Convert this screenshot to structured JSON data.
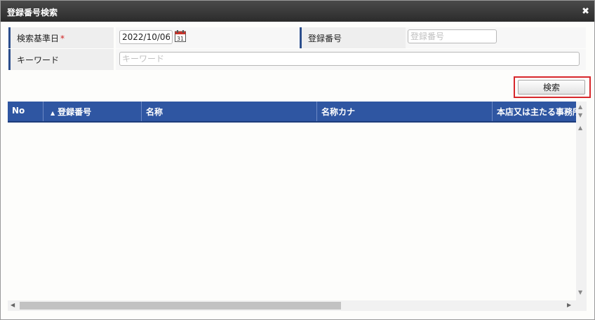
{
  "dialog": {
    "title": "登録番号検索",
    "close_icon": "close-icon",
    "close_glyph": "✖"
  },
  "form": {
    "date_label": "検索基準日",
    "required_mark": "*",
    "date_value": "2022/10/06",
    "calendar_icon": "calendar-icon",
    "calendar_day": "31",
    "regno_label": "登録番号",
    "regno_placeholder": "登録番号",
    "keyword_label": "キーワード",
    "keyword_placeholder": "キーワード"
  },
  "actions": {
    "search_label": "検索"
  },
  "grid": {
    "columns": [
      {
        "label": "No",
        "sort": ""
      },
      {
        "label": "登録番号",
        "sort": "▲"
      },
      {
        "label": "名称",
        "sort": ""
      },
      {
        "label": "名称カナ",
        "sort": ""
      },
      {
        "label": "本店又は主たる事務所",
        "sort": ""
      }
    ],
    "rows": []
  },
  "colors": {
    "header_bg": "#2f56a2",
    "accent_border": "#2c4e8c",
    "highlight_red": "#d7272b"
  }
}
